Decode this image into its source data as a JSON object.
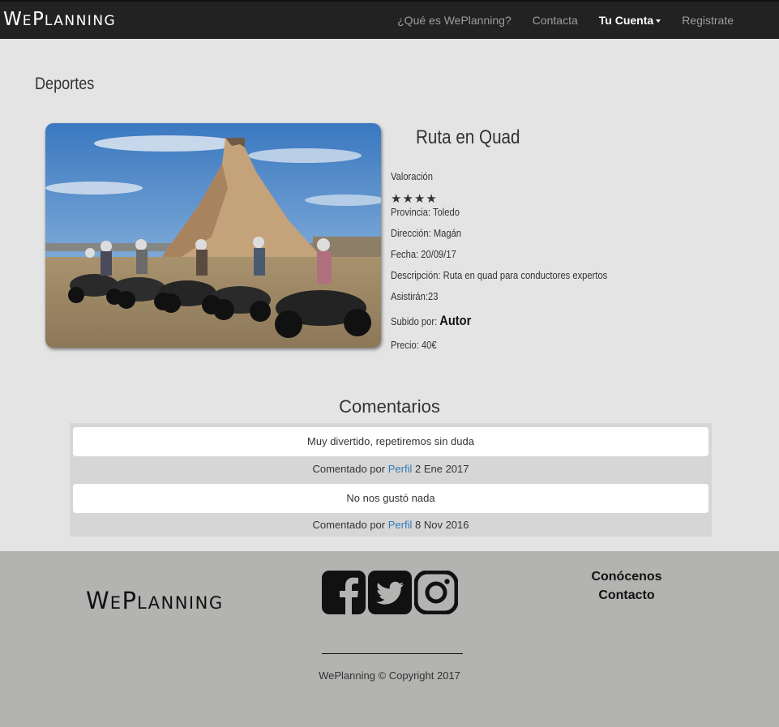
{
  "nav": {
    "brand_big1": "W",
    "brand_small1": "E",
    "brand_big2": "P",
    "brand_small2": "LANNING",
    "links": [
      {
        "label": "¿Qué es WePlanning?"
      },
      {
        "label": "Contacta"
      },
      {
        "label": "Tu Cuenta"
      },
      {
        "label": "Registrate"
      }
    ]
  },
  "category": "Deportes",
  "event": {
    "title": "Ruta en Quad",
    "rating_label": "Valoración",
    "rating": 4,
    "stars": "★★★★",
    "province_label": "Provincia:",
    "province": "Toledo",
    "address_label": "Dirección:",
    "address": "Magán",
    "date_label": "Fecha:",
    "date": "20/09/17",
    "description_label": "Descripción:",
    "description": "Ruta en quad para conductores expertos",
    "attendees_label": "Asistirán:",
    "attendees": "23",
    "uploaded_label": "Subido por:",
    "author": "Autor",
    "price_label": "Precio:",
    "price": "40€"
  },
  "comments": {
    "title": "Comentarios",
    "items": [
      {
        "text": "Muy divertido, repetiremos sin duda",
        "meta_prefix": "Comentado por",
        "author": "Perfil",
        "date": "2 Ene 2017"
      },
      {
        "text": "No nos gustó nada",
        "meta_prefix": "Comentado por",
        "author": "Perfil",
        "date": "8 Nov 2016"
      }
    ]
  },
  "footer": {
    "links": [
      {
        "label": "Conócenos"
      },
      {
        "label": "Contacto"
      }
    ],
    "copyright": "WePlanning © Copyright 2017",
    "icons": [
      "facebook-icon",
      "twitter-icon",
      "instagram-icon"
    ]
  },
  "colors": {
    "navbar": "#222222",
    "link": "#337ab7",
    "footer": "#b3b3b1"
  }
}
